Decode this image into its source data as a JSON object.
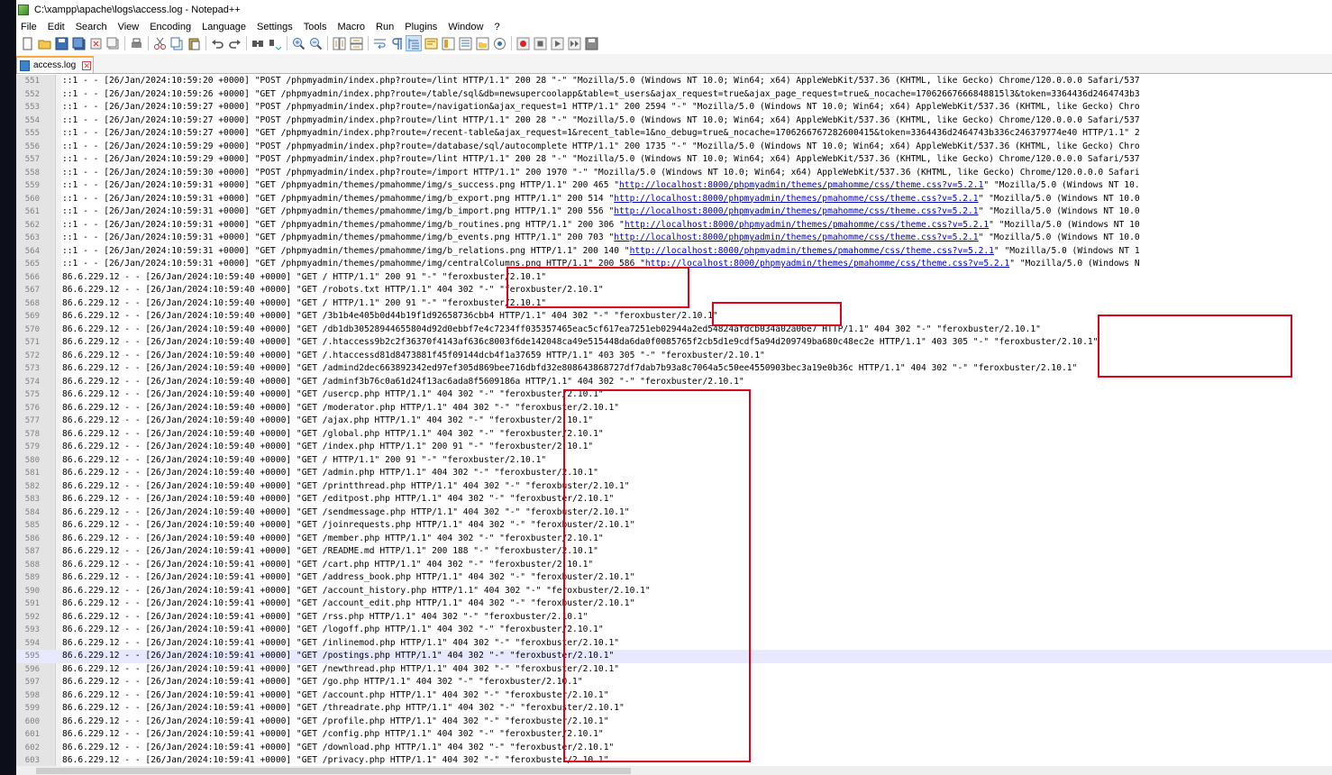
{
  "window": {
    "title": "C:\\xampp\\apache\\logs\\access.log - Notepad++"
  },
  "menu": [
    "File",
    "Edit",
    "Search",
    "View",
    "Encoding",
    "Language",
    "Settings",
    "Tools",
    "Macro",
    "Run",
    "Plugins",
    "Window",
    "?"
  ],
  "toolbar": {
    "icons": [
      "new-file-icon",
      "open-file-icon",
      "save-icon",
      "save-all-icon",
      "close-icon",
      "close-all-icon",
      "print-icon",
      "cut-icon",
      "copy-icon",
      "paste-icon",
      "undo-icon",
      "redo-icon",
      "find-icon",
      "replace-icon",
      "zoom-in-icon",
      "zoom-out-icon",
      "sync-vertical-icon",
      "sync-horizontal-icon",
      "word-wrap-icon",
      "show-all-characters-icon",
      "indent-guide-icon",
      "user-defined-language-icon",
      "document-map-icon",
      "function-list-icon",
      "folder-as-workspace-icon",
      "monitoring-icon",
      "record-macro-icon",
      "stop-recording-icon",
      "play-macro-icon",
      "run-macro-multiple-icon",
      "save-macro-icon"
    ]
  },
  "tab": {
    "label": "access.log"
  },
  "editor": {
    "current_line": 595,
    "lines": [
      {
        "n": "551",
        "text": "::1 - - [26/Jan/2024:10:59:20 +0000] \"POST /phpmyadmin/index.php?route=/lint HTTP/1.1\" 200 28 \"-\" \"Mozilla/5.0 (Windows NT 10.0; Win64; x64) AppleWebKit/537.36 (KHTML, like Gecko) Chrome/120.0.0.0 Safari/537"
      },
      {
        "n": "552",
        "text": "::1 - - [26/Jan/2024:10:59:26 +0000] \"GET /phpmyadmin/index.php?route=/table/sql&db=newsupercoolapp&table=t_users&ajax_request=true&ajax_page_request=true&_nocache=17062667666848815l3&token=3364436d2464743b3"
      },
      {
        "n": "553",
        "text": "::1 - - [26/Jan/2024:10:59:27 +0000] \"POST /phpmyadmin/index.php?route=/navigation&ajax_request=1 HTTP/1.1\" 200 2594 \"-\" \"Mozilla/5.0 (Windows NT 10.0; Win64; x64) AppleWebKit/537.36 (KHTML, like Gecko) Chro"
      },
      {
        "n": "554",
        "text": "::1 - - [26/Jan/2024:10:59:27 +0000] \"POST /phpmyadmin/index.php?route=/lint HTTP/1.1\" 200 28 \"-\" \"Mozilla/5.0 (Windows NT 10.0; Win64; x64) AppleWebKit/537.36 (KHTML, like Gecko) Chrome/120.0.0.0 Safari/537"
      },
      {
        "n": "555",
        "text": "::1 - - [26/Jan/2024:10:59:27 +0000] \"GET /phpmyadmin/index.php?route=/recent-table&ajax_request=1&recent_table=1&no_debug=true&_nocache=1706266767282600415&token=3364436d2464743b336c246379774e40 HTTP/1.1\" 2"
      },
      {
        "n": "556",
        "text": "::1 - - [26/Jan/2024:10:59:29 +0000] \"POST /phpmyadmin/index.php?route=/database/sql/autocomplete HTTP/1.1\" 200 1735 \"-\" \"Mozilla/5.0 (Windows NT 10.0; Win64; x64) AppleWebKit/537.36 (KHTML, like Gecko) Chro"
      },
      {
        "n": "557",
        "text": "::1 - - [26/Jan/2024:10:59:29 +0000] \"POST /phpmyadmin/index.php?route=/lint HTTP/1.1\" 200 28 \"-\" \"Mozilla/5.0 (Windows NT 10.0; Win64; x64) AppleWebKit/537.36 (KHTML, like Gecko) Chrome/120.0.0.0 Safari/537"
      },
      {
        "n": "558",
        "text": "::1 - - [26/Jan/2024:10:59:30 +0000] \"POST /phpmyadmin/index.php?route=/import HTTP/1.1\" 200 1970 \"-\" \"Mozilla/5.0 (Windows NT 10.0; Win64; x64) AppleWebKit/537.36 (KHTML, like Gecko) Chrome/120.0.0.0 Safari"
      },
      {
        "n": "559",
        "text": "::1 - - [26/Jan/2024:10:59:31 +0000] \"GET /phpmyadmin/themes/pmahomme/img/s_success.png HTTP/1.1\" 200 465 \"",
        "url": "http://localhost:8000/phpmyadmin/themes/pmahomme/css/theme.css?v=5.2.1",
        "after": "\" \"Mozilla/5.0 (Windows NT 10."
      },
      {
        "n": "560",
        "text": "::1 - - [26/Jan/2024:10:59:31 +0000] \"GET /phpmyadmin/themes/pmahomme/img/b_export.png HTTP/1.1\" 200 514 \"",
        "url": "http://localhost:8000/phpmyadmin/themes/pmahomme/css/theme.css?v=5.2.1",
        "after": "\" \"Mozilla/5.0 (Windows NT 10.0"
      },
      {
        "n": "561",
        "text": "::1 - - [26/Jan/2024:10:59:31 +0000] \"GET /phpmyadmin/themes/pmahomme/img/b_import.png HTTP/1.1\" 200 556 \"",
        "url": "http://localhost:8000/phpmyadmin/themes/pmahomme/css/theme.css?v=5.2.1",
        "after": "\" \"Mozilla/5.0 (Windows NT 10.0"
      },
      {
        "n": "562",
        "text": "::1 - - [26/Jan/2024:10:59:31 +0000] \"GET /phpmyadmin/themes/pmahomme/img/b_routines.png HTTP/1.1\" 200 306 \"",
        "url": "http://localhost:8000/phpmyadmin/themes/pmahomme/css/theme.css?v=5.2.1",
        "after": "\" \"Mozilla/5.0 (Windows NT 10"
      },
      {
        "n": "563",
        "text": "::1 - - [26/Jan/2024:10:59:31 +0000] \"GET /phpmyadmin/themes/pmahomme/img/b_events.png HTTP/1.1\" 200 703 \"",
        "url": "http://localhost:8000/phpmyadmin/themes/pmahomme/css/theme.css?v=5.2.1",
        "after": "\" \"Mozilla/5.0 (Windows NT 10.0"
      },
      {
        "n": "564",
        "text": "::1 - - [26/Jan/2024:10:59:31 +0000] \"GET /phpmyadmin/themes/pmahomme/img/b_relations.png HTTP/1.1\" 200 140 \"",
        "url": "http://localhost:8000/phpmyadmin/themes/pmahomme/css/theme.css?v=5.2.1",
        "after": "\" \"Mozilla/5.0 (Windows NT 1"
      },
      {
        "n": "565",
        "text": "::1 - - [26/Jan/2024:10:59:31 +0000] \"GET /phpmyadmin/themes/pmahomme/img/centralColumns.png HTTP/1.1\" 200 586 \"",
        "url": "http://localhost:8000/phpmyadmin/themes/pmahomme/css/theme.css?v=5.2.1",
        "after": "\" \"Mozilla/5.0 (Windows N"
      },
      {
        "n": "566",
        "text": "86.6.229.12 - - [26/Jan/2024:10:59:40 +0000] \"GET / HTTP/1.1\" 200 91 \"-\" \"feroxbuster/2.10.1\""
      },
      {
        "n": "567",
        "text": "86.6.229.12 - - [26/Jan/2024:10:59:40 +0000] \"GET /robots.txt HTTP/1.1\" 404 302 \"-\" \"feroxbuster/2.10.1\""
      },
      {
        "n": "568",
        "text": "86.6.229.12 - - [26/Jan/2024:10:59:40 +0000] \"GET / HTTP/1.1\" 200 91 \"-\" \"feroxbuster/2.10.1\""
      },
      {
        "n": "569",
        "text": "86.6.229.12 - - [26/Jan/2024:10:59:40 +0000] \"GET /3b1b4e405b0d44b19f1d92658736cbb4 HTTP/1.1\" 404 302 \"-\" \"feroxbuster/2.10.1\""
      },
      {
        "n": "570",
        "text": "86.6.229.12 - - [26/Jan/2024:10:59:40 +0000] \"GET /db1db30528944655804d92d0ebbf7e4c7234ff035357465eac5cf617ea7251eb02944a2ed54824afdcb034a02a06e7 HTTP/1.1\" 404 302 \"-\" \"feroxbuster/2.10.1\""
      },
      {
        "n": "571",
        "text": "86.6.229.12 - - [26/Jan/2024:10:59:40 +0000] \"GET /.htaccess9b2c2f36370f4143af636c8003f6de142048ca49e515448da6da0f0085765f2cb5d1e9cdf5a94d209749ba680c48ec2e HTTP/1.1\" 403 305 \"-\" \"feroxbuster/2.10.1\""
      },
      {
        "n": "572",
        "text": "86.6.229.12 - - [26/Jan/2024:10:59:40 +0000] \"GET /.htaccessd81d8473881f45f09144dcb4f1a37659 HTTP/1.1\" 403 305 \"-\" \"feroxbuster/2.10.1\""
      },
      {
        "n": "573",
        "text": "86.6.229.12 - - [26/Jan/2024:10:59:40 +0000] \"GET /admind2dec663892342ed97ef305d869bee716dbfd32e808643868727df7dab7b93a8c7064a5c50ee4550903bec3a19e0b36c HTTP/1.1\" 404 302 \"-\" \"feroxbuster/2.10.1\""
      },
      {
        "n": "574",
        "text": "86.6.229.12 - - [26/Jan/2024:10:59:40 +0000] \"GET /adminf3b76c0a61d24f13ac6ada8f5609186a HTTP/1.1\" 404 302 \"-\" \"feroxbuster/2.10.1\""
      },
      {
        "n": "575",
        "text": "86.6.229.12 - - [26/Jan/2024:10:59:40 +0000] \"GET /usercp.php HTTP/1.1\" 404 302 \"-\" \"feroxbuster/2.10.1\""
      },
      {
        "n": "576",
        "text": "86.6.229.12 - - [26/Jan/2024:10:59:40 +0000] \"GET /moderator.php HTTP/1.1\" 404 302 \"-\" \"feroxbuster/2.10.1\""
      },
      {
        "n": "577",
        "text": "86.6.229.12 - - [26/Jan/2024:10:59:40 +0000] \"GET /ajax.php HTTP/1.1\" 404 302 \"-\" \"feroxbuster/2.10.1\""
      },
      {
        "n": "578",
        "text": "86.6.229.12 - - [26/Jan/2024:10:59:40 +0000] \"GET /global.php HTTP/1.1\" 404 302 \"-\" \"feroxbuster/2.10.1\""
      },
      {
        "n": "579",
        "text": "86.6.229.12 - - [26/Jan/2024:10:59:40 +0000] \"GET /index.php HTTP/1.1\" 200 91 \"-\" \"feroxbuster/2.10.1\""
      },
      {
        "n": "580",
        "text": "86.6.229.12 - - [26/Jan/2024:10:59:40 +0000] \"GET / HTTP/1.1\" 200 91 \"-\" \"feroxbuster/2.10.1\""
      },
      {
        "n": "581",
        "text": "86.6.229.12 - - [26/Jan/2024:10:59:40 +0000] \"GET /admin.php HTTP/1.1\" 404 302 \"-\" \"feroxbuster/2.10.1\""
      },
      {
        "n": "582",
        "text": "86.6.229.12 - - [26/Jan/2024:10:59:40 +0000] \"GET /printthread.php HTTP/1.1\" 404 302 \"-\" \"feroxbuster/2.10.1\""
      },
      {
        "n": "583",
        "text": "86.6.229.12 - - [26/Jan/2024:10:59:40 +0000] \"GET /editpost.php HTTP/1.1\" 404 302 \"-\" \"feroxbuster/2.10.1\""
      },
      {
        "n": "584",
        "text": "86.6.229.12 - - [26/Jan/2024:10:59:40 +0000] \"GET /sendmessage.php HTTP/1.1\" 404 302 \"-\" \"feroxbuster/2.10.1\""
      },
      {
        "n": "585",
        "text": "86.6.229.12 - - [26/Jan/2024:10:59:40 +0000] \"GET /joinrequests.php HTTP/1.1\" 404 302 \"-\" \"feroxbuster/2.10.1\""
      },
      {
        "n": "586",
        "text": "86.6.229.12 - - [26/Jan/2024:10:59:40 +0000] \"GET /member.php HTTP/1.1\" 404 302 \"-\" \"feroxbuster/2.10.1\""
      },
      {
        "n": "587",
        "text": "86.6.229.12 - - [26/Jan/2024:10:59:41 +0000] \"GET /README.md HTTP/1.1\" 200 188 \"-\" \"feroxbuster/2.10.1\""
      },
      {
        "n": "588",
        "text": "86.6.229.12 - - [26/Jan/2024:10:59:41 +0000] \"GET /cart.php HTTP/1.1\" 404 302 \"-\" \"feroxbuster/2.10.1\""
      },
      {
        "n": "589",
        "text": "86.6.229.12 - - [26/Jan/2024:10:59:41 +0000] \"GET /address_book.php HTTP/1.1\" 404 302 \"-\" \"feroxbuster/2.10.1\""
      },
      {
        "n": "590",
        "text": "86.6.229.12 - - [26/Jan/2024:10:59:41 +0000] \"GET /account_history.php HTTP/1.1\" 404 302 \"-\" \"feroxbuster/2.10.1\""
      },
      {
        "n": "591",
        "text": "86.6.229.12 - - [26/Jan/2024:10:59:41 +0000] \"GET /account_edit.php HTTP/1.1\" 404 302 \"-\" \"feroxbuster/2.10.1\""
      },
      {
        "n": "592",
        "text": "86.6.229.12 - - [26/Jan/2024:10:59:41 +0000] \"GET /rss.php HTTP/1.1\" 404 302 \"-\" \"feroxbuster/2.10.1\""
      },
      {
        "n": "593",
        "text": "86.6.229.12 - - [26/Jan/2024:10:59:41 +0000] \"GET /logoff.php HTTP/1.1\" 404 302 \"-\" \"feroxbuster/2.10.1\""
      },
      {
        "n": "594",
        "text": "86.6.229.12 - - [26/Jan/2024:10:59:41 +0000] \"GET /inlinemod.php HTTP/1.1\" 404 302 \"-\" \"feroxbuster/2.10.1\""
      },
      {
        "n": "595",
        "text": "86.6.229.12 - - [26/Jan/2024:10:59:41 +0000] \"GET /postings.php HTTP/1.1\" 404 302 \"-\" \"feroxbuster/2.10.1\""
      },
      {
        "n": "596",
        "text": "86.6.229.12 - - [26/Jan/2024:10:59:41 +0000] \"GET /newthread.php HTTP/1.1\" 404 302 \"-\" \"feroxbuster/2.10.1\""
      },
      {
        "n": "597",
        "text": "86.6.229.12 - - [26/Jan/2024:10:59:41 +0000] \"GET /go.php HTTP/1.1\" 404 302 \"-\" \"feroxbuster/2.10.1\""
      },
      {
        "n": "598",
        "text": "86.6.229.12 - - [26/Jan/2024:10:59:41 +0000] \"GET /account.php HTTP/1.1\" 404 302 \"-\" \"feroxbuster/2.10.1\""
      },
      {
        "n": "599",
        "text": "86.6.229.12 - - [26/Jan/2024:10:59:41 +0000] \"GET /threadrate.php HTTP/1.1\" 404 302 \"-\" \"feroxbuster/2.10.1\""
      },
      {
        "n": "600",
        "text": "86.6.229.12 - - [26/Jan/2024:10:59:41 +0000] \"GET /profile.php HTTP/1.1\" 404 302 \"-\" \"feroxbuster/2.10.1\""
      },
      {
        "n": "601",
        "text": "86.6.229.12 - - [26/Jan/2024:10:59:41 +0000] \"GET /config.php HTTP/1.1\" 404 302 \"-\" \"feroxbuster/2.10.1\""
      },
      {
        "n": "602",
        "text": "86.6.229.12 - - [26/Jan/2024:10:59:41 +0000] \"GET /download.php HTTP/1.1\" 404 302 \"-\" \"feroxbuster/2.10.1\""
      },
      {
        "n": "603",
        "text": "86.6.229.12 - - [26/Jan/2024:10:59:41 +0000] \"GET /privacy.php HTTP/1.1\" 404 302 \"-\" \"feroxbuster/2.10.1\""
      }
    ]
  },
  "annotation": {
    "color": "#e0001b"
  }
}
